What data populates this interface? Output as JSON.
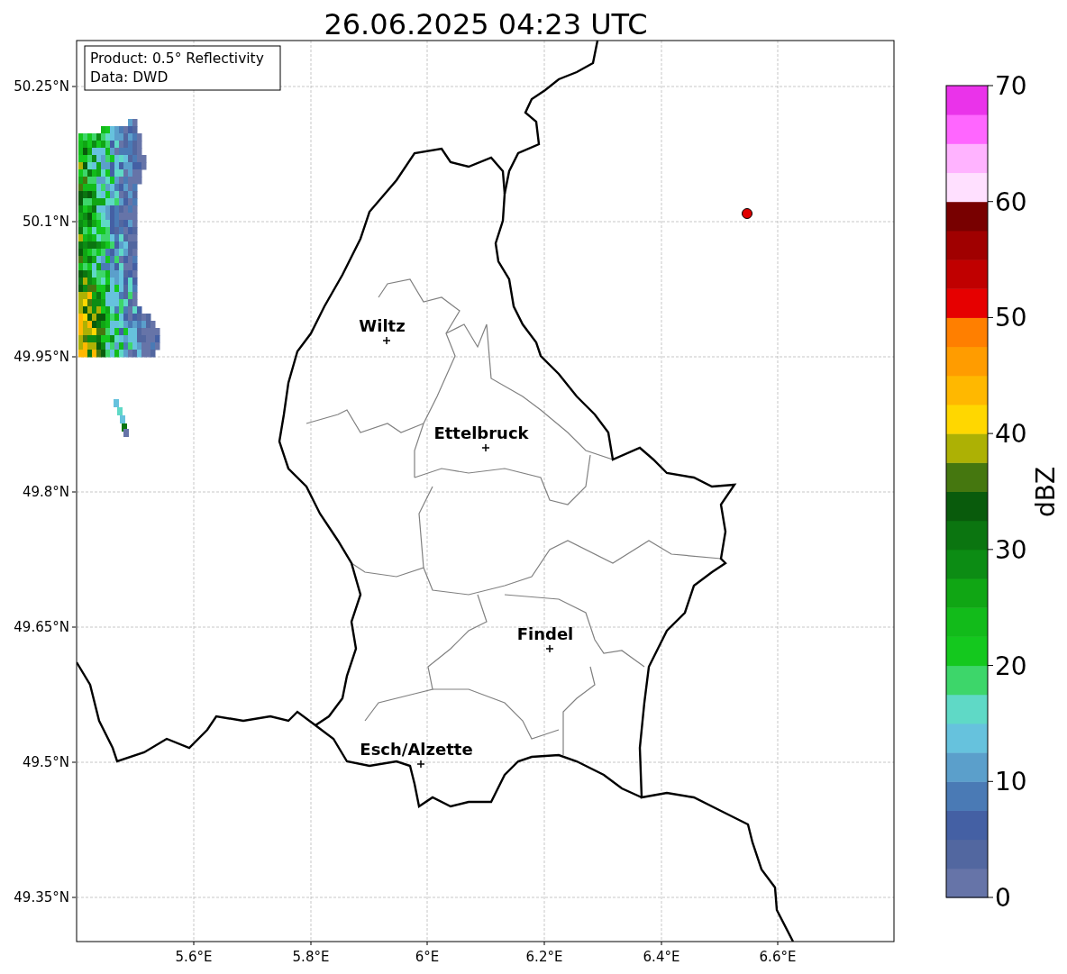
{
  "title": "26.06.2025 04:23 UTC",
  "info_box": [
    "Product: 0.5° Reflectivity",
    "Data: DWD"
  ],
  "map": {
    "y_ticks": [
      "50.25°N",
      "50.1°N",
      "49.95°N",
      "49.8°N",
      "49.65°N",
      "49.5°N",
      "49.35°N"
    ],
    "x_ticks": [
      "5.6°E",
      "5.8°E",
      "6°E",
      "6.2°E",
      "6.4°E",
      "6.6°E"
    ],
    "cities": [
      {
        "name": "Wiltz"
      },
      {
        "name": "Ettelbruck"
      },
      {
        "name": "Findel"
      },
      {
        "name": "Esch/Alzette"
      }
    ]
  },
  "colorbar": {
    "label": "dBZ",
    "ticks": [
      "70",
      "60",
      "50",
      "40",
      "30",
      "20",
      "10",
      "0"
    ],
    "bands": [
      {
        "color": "#6674a8"
      },
      {
        "color": "#5267a0"
      },
      {
        "color": "#4460a4"
      },
      {
        "color": "#4a7ab5"
      },
      {
        "color": "#5b9fcb"
      },
      {
        "color": "#66c2dd"
      },
      {
        "color": "#5fd9c6"
      },
      {
        "color": "#3dd66a"
      },
      {
        "color": "#14c81e"
      },
      {
        "color": "#12bb1a"
      },
      {
        "color": "#10a614"
      },
      {
        "color": "#0c8c14"
      },
      {
        "color": "#0b7510"
      },
      {
        "color": "#095b0c"
      },
      {
        "color": "#45770f"
      },
      {
        "color": "#adb104"
      },
      {
        "color": "#ffd700"
      },
      {
        "color": "#ffb800"
      },
      {
        "color": "#ff9c00"
      },
      {
        "color": "#ff7f00"
      },
      {
        "color": "#e60000"
      },
      {
        "color": "#c00000"
      },
      {
        "color": "#a00000"
      },
      {
        "color": "#780000"
      },
      {
        "color": "#ffe0ff"
      },
      {
        "color": "#ffb3ff"
      },
      {
        "color": "#ff66ff"
      },
      {
        "color": "#ea33ea"
      }
    ]
  }
}
